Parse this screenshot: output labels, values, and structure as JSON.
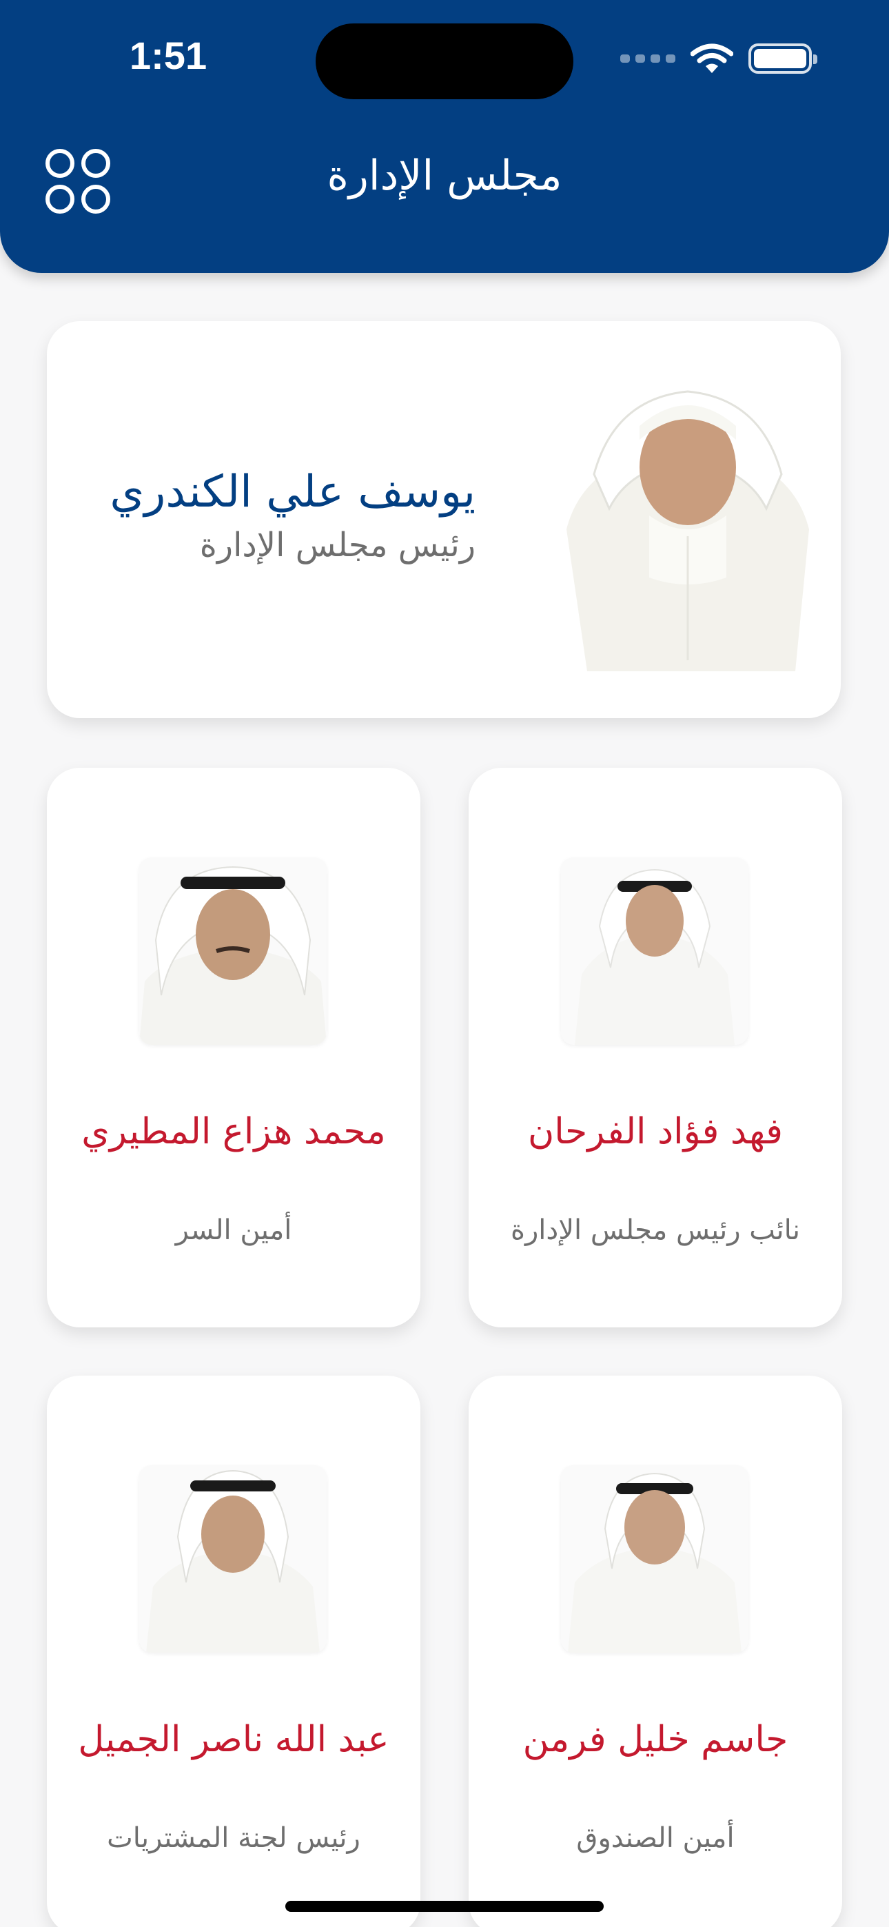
{
  "status_bar": {
    "time": "1:51"
  },
  "header": {
    "title": "مجلس الإدارة",
    "menu_icon": "grid-circles-icon"
  },
  "colors": {
    "header_bg": "#033f82",
    "name_red": "#c4192e",
    "name_blue": "#033f82",
    "role_gray": "#6e6e6e"
  },
  "chair": {
    "name": "يوسف علي الكندري",
    "role": "رئيس مجلس الإدارة"
  },
  "members": [
    {
      "name": "فهد فؤاد الفرحان",
      "role": "نائب رئيس مجلس الإدارة"
    },
    {
      "name": "محمد هزاع المطيري",
      "role": "أمين السر"
    },
    {
      "name": "جاسم خليل فرمن",
      "role": "أمين الصندوق"
    },
    {
      "name": "عبد الله ناصر الجميل",
      "role": "رئيس لجنة المشتريات"
    }
  ]
}
